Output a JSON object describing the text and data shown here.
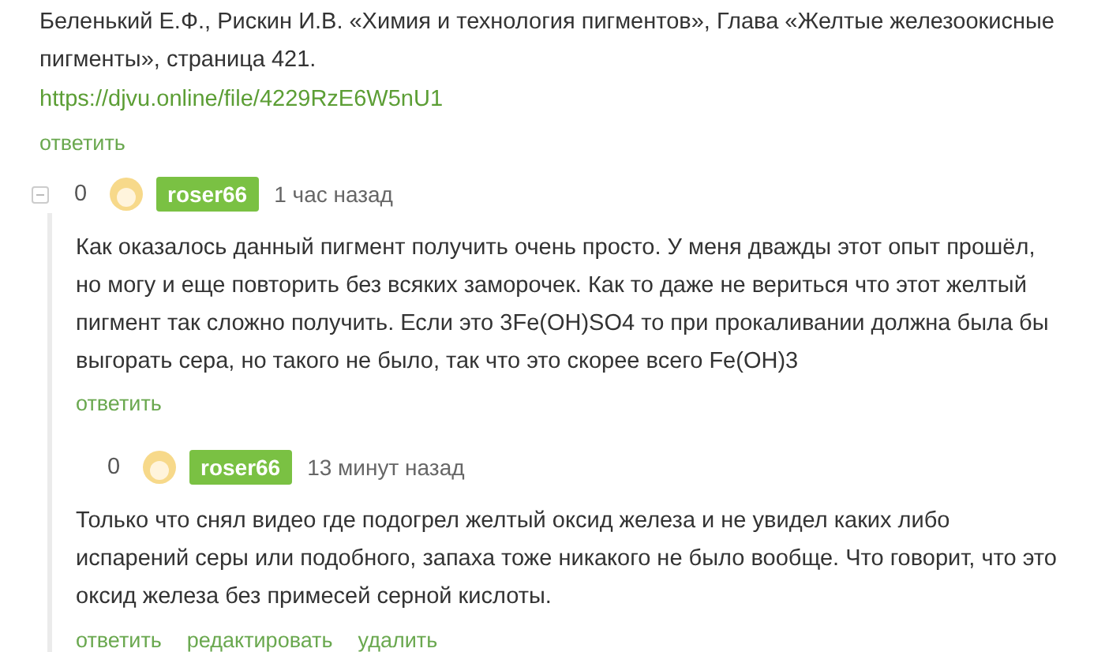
{
  "parent_comment": {
    "text": "Беленький Е.Ф., Рискин И.В. «Химия и технология пигментов», Глава «Желтые железоокисные пигменты», страница 421.",
    "link": "https://djvu.online/file/4229RzE6W5nU1",
    "actions": [
      "ответить"
    ]
  },
  "comments": [
    {
      "collapsible": true,
      "rating": "0",
      "author": "roser66",
      "time": "1 час назад",
      "text": "Как оказалось данный пигмент получить очень просто. У меня дважды этот опыт прошёл, но могу и еще повторить без всяких заморочек. Как то даже не вериться что этот желтый пигмент так сложно получить. Если это 3Fe(OH)SO4 то при прокаливании должна была бы выгорать сера, но такого не было, так что это скорее всего Fe(OH)3",
      "actions": [
        "ответить"
      ],
      "children": [
        {
          "collapsible": false,
          "rating": "0",
          "author": "roser66",
          "time": "13 минут назад",
          "text": "Только что снял видео где подогрел желтый оксид железа и не увидел каких либо испарений серы или подобного, запаха тоже никакого не было вообще. Что говорит, что это оксид железа без примесей серной кислоты.",
          "actions": [
            "ответить",
            "редактировать",
            "удалить"
          ]
        }
      ]
    }
  ]
}
